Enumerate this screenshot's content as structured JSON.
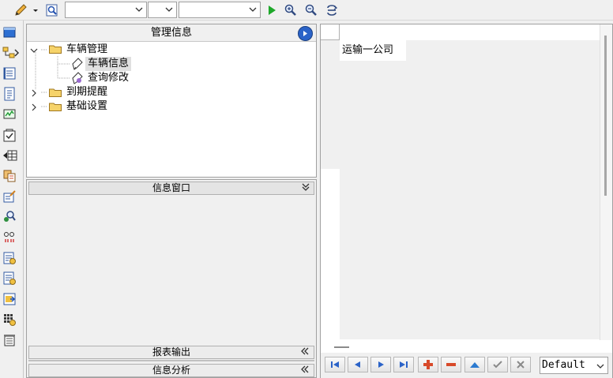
{
  "toolbar": {
    "combo1_value": "",
    "combo2_value": "",
    "combo3_value": ""
  },
  "panel": {
    "title": "管理信息"
  },
  "tree": [
    {
      "label": "车辆管理",
      "expanded": true
    },
    {
      "label": "车辆信息",
      "selected": true
    },
    {
      "label": "查询修改"
    },
    {
      "label": "到期提醒",
      "expanded": false
    },
    {
      "label": "基础设置",
      "expanded": false
    }
  ],
  "info_window": {
    "title": "信息窗口"
  },
  "bottom_bars": {
    "report_output": "报表输出",
    "info_analysis": "信息分析"
  },
  "grid": {
    "cell_text": "运输一公司"
  },
  "navigator": {
    "view_select": "Default"
  },
  "colors": {
    "nav_blue": "#2b63c8",
    "nav_red": "#d84a2a",
    "play_green": "#1ea82a",
    "folder_yellow": "#f6d36a"
  }
}
